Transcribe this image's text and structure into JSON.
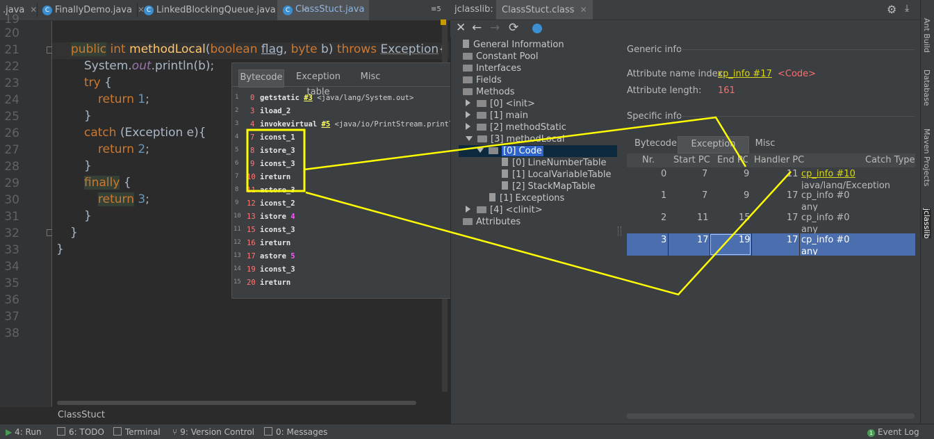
{
  "tabs": [
    {
      "label": ".java",
      "active": false
    },
    {
      "label": "FinallyDemo.java",
      "active": false
    },
    {
      "label": "LinkedBlockingQueue.java",
      "active": false
    },
    {
      "label": "ClassStuct.java",
      "active": true
    }
  ],
  "tab_overflow": "≡5",
  "code_lines": [
    "20",
    "21",
    "22",
    "23",
    "24",
    "25",
    "26",
    "27",
    "28",
    "29",
    "30",
    "31",
    "32",
    "33",
    "34",
    "35",
    "36",
    "37",
    "38"
  ],
  "code": {
    "l21": {
      "kw1": "public",
      "kw2": "int",
      "name": "methodLocal",
      "p1": "(",
      "kw3": "boolean",
      "p2": "flag",
      "p3": ", ",
      "kw4": "byte",
      "p4": " b) ",
      "kw5": "throws",
      "p5": " ",
      "ex": "Exception",
      "p6": "{"
    },
    "l22": {
      "a": "System.",
      "b": "out",
      "c": ".println(b);"
    },
    "l23": {
      "kw": "try",
      "p": " {"
    },
    "l24": {
      "kw": "return",
      "n": "1",
      "p": ";"
    },
    "l25": {
      "p": "}"
    },
    "l26": {
      "kw": "catch",
      "p": " (Exception e){"
    },
    "l27": {
      "kw": "return",
      "n": "2",
      "p": ";"
    },
    "l28": {
      "p": "}"
    },
    "l29": {
      "kw": "finally",
      "p": " {"
    },
    "l30": {
      "kw": "return",
      "n": "3",
      "p": ";"
    },
    "l31": {
      "p": "}"
    },
    "l32": {
      "p": "}"
    },
    "l33": {
      "p": "}"
    }
  },
  "editor_footer": "ClassStuct",
  "popup": {
    "tabs": [
      "Bytecode",
      "Exception table",
      "Misc"
    ],
    "lines": [
      {
        "n": "1",
        "off": "0",
        "ins": "getstatic",
        "ref": "#3",
        "cmt": "<java/lang/System.out>"
      },
      {
        "n": "2",
        "off": "3",
        "ins": "iload_2"
      },
      {
        "n": "3",
        "off": "4",
        "ins": "invokevirtual",
        "ref": "#5",
        "cmt": "<java/io/PrintStream.println>"
      },
      {
        "n": "4",
        "off": "7",
        "ins": "iconst_1"
      },
      {
        "n": "5",
        "off": "8",
        "ins": "istore_3"
      },
      {
        "n": "6",
        "off": "9",
        "ins": "iconst_3"
      },
      {
        "n": "7",
        "off": "10",
        "ins": "ireturn"
      },
      {
        "n": "8",
        "off": "11",
        "ins": "astore_3"
      },
      {
        "n": "9",
        "off": "12",
        "ins": "iconst_2"
      },
      {
        "n": "10",
        "off": "13",
        "ins": "istore",
        "arg": "4"
      },
      {
        "n": "11",
        "off": "15",
        "ins": "iconst_3"
      },
      {
        "n": "12",
        "off": "16",
        "ins": "ireturn"
      },
      {
        "n": "13",
        "off": "17",
        "ins": "astore",
        "arg": "5"
      },
      {
        "n": "14",
        "off": "19",
        "ins": "iconst_3"
      },
      {
        "n": "15",
        "off": "20",
        "ins": "ireturn"
      }
    ]
  },
  "jclasslib": {
    "title": "jclasslib:",
    "file_tab": "ClassStuct.class",
    "toolbar": [
      "close-icon",
      "back-icon",
      "forward-icon",
      "refresh-icon",
      "globe-icon"
    ],
    "tree": {
      "general": "General Information",
      "pool": "Constant Pool",
      "interfaces": "Interfaces",
      "fields": "Fields",
      "methods": "Methods",
      "m0": "[0] <init>",
      "m1": "[1] main",
      "m2": "[2] methodStatic",
      "m3": "[3] methodLocal",
      "code": "[0] Code",
      "lnt": "[0] LineNumberTable",
      "lvt": "[1] LocalVariableTable",
      "smt": "[2] StackMapTable",
      "exc": "[1] Exceptions",
      "m4": "[4] <clinit>",
      "attrs": "Attributes"
    },
    "generic_info": "Generic info",
    "attr_name_label": "Attribute name index:",
    "attr_name_link": "cp_info #17",
    "attr_name_value": "<Code>",
    "attr_len_label": "Attribute length:",
    "attr_len_value": "161",
    "specific_info": "Specific info",
    "sub_tabs": [
      "Bytecode",
      "Exception table",
      "Misc"
    ],
    "columns": [
      "Nr.",
      "Start PC",
      "End PC",
      "Handler PC",
      "Catch Type"
    ],
    "rows": [
      {
        "nr": "0",
        "start": "7",
        "end": "9",
        "handler": "11",
        "type": "cp_info #10",
        "type2": "java/lang/Exception"
      },
      {
        "nr": "1",
        "start": "7",
        "end": "9",
        "handler": "17",
        "type": "cp_info #0",
        "type2": "any"
      },
      {
        "nr": "2",
        "start": "11",
        "end": "15",
        "handler": "17",
        "type": "cp_info #0",
        "type2": "any"
      },
      {
        "nr": "3",
        "start": "17",
        "end": "19",
        "handler": "17",
        "type": "cp_info #0",
        "type2": "any"
      }
    ]
  },
  "side_tools": [
    "Ant Build",
    "Database",
    "Maven Projects",
    "jclasslib"
  ],
  "status": {
    "run": "4: Run",
    "todo": "6: TODO",
    "terminal": "Terminal",
    "vcs": "9: Version Control",
    "messages": "0: Messages",
    "event_log": "Event Log",
    "event_count": "1"
  },
  "colors": {
    "annotation": "#ffff00",
    "selection": "#4b6eaf",
    "link": "#d7d71a"
  }
}
